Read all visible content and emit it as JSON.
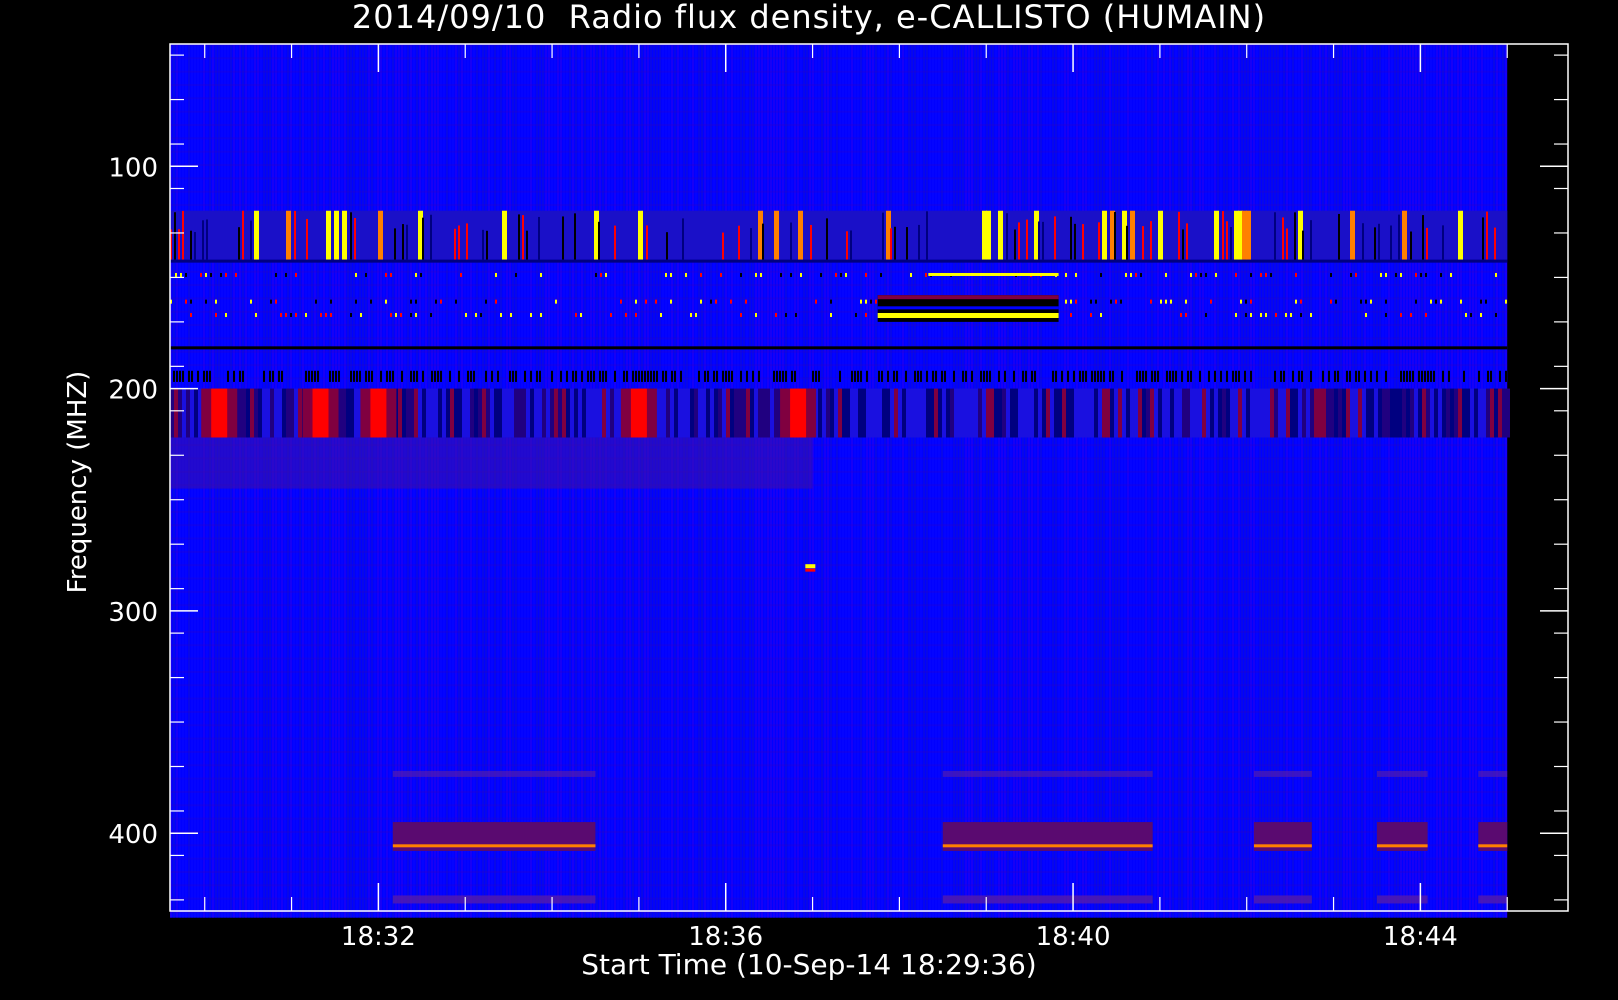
{
  "chart_data": {
    "type": "heatmap",
    "title": "2014/09/10  Radio flux density, e-CALLISTO (HUMAIN)",
    "xlabel": "Start Time (10-Sep-14 18:29:36)",
    "ylabel": "Frequency (MHZ)",
    "x_start": "18:29:36",
    "x_end": "18:45:00",
    "xlim_minutes_after_1830": [
      -0.4,
      15.7
    ],
    "ylim_mhz": [
      435,
      45
    ],
    "x_ticks": [
      "18:32",
      "18:36",
      "18:40",
      "18:44"
    ],
    "y_ticks": [
      100,
      200,
      300,
      400
    ],
    "data_extent": {
      "time": [
        "18:29:36",
        "18:45:00"
      ],
      "freq_mhz": [
        45,
        438
      ]
    },
    "colormap": [
      "#000000",
      "#000080",
      "#0000ff",
      "#800040",
      "#ff0000",
      "#ff8000",
      "#ffff00",
      "#ffffff"
    ],
    "background_color": "#0000ff",
    "features": [
      {
        "kind": "rfi_band",
        "freq_mhz": [
          120,
          142
        ],
        "description": "intermittent bright bursts"
      },
      {
        "kind": "rfi_lines",
        "freq_mhz": [
          145,
          170
        ],
        "strong_interval": [
          "18:38:20",
          "18:39:50"
        ]
      },
      {
        "kind": "band",
        "freq_mhz": [
          200,
          222
        ],
        "hot_times": [
          "18:30:10",
          "18:31:20",
          "18:32:00",
          "18:35:00",
          "18:36:50"
        ]
      },
      {
        "kind": "carrier",
        "freq_mhz": 406,
        "intervals": [
          [
            "18:32:10",
            "18:34:30"
          ],
          [
            "18:38:30",
            "18:40:55"
          ],
          [
            "18:42:05",
            "18:42:45"
          ],
          [
            "18:43:30",
            "18:44:05"
          ],
          [
            "18:44:40",
            "18:45:00"
          ]
        ]
      }
    ]
  }
}
